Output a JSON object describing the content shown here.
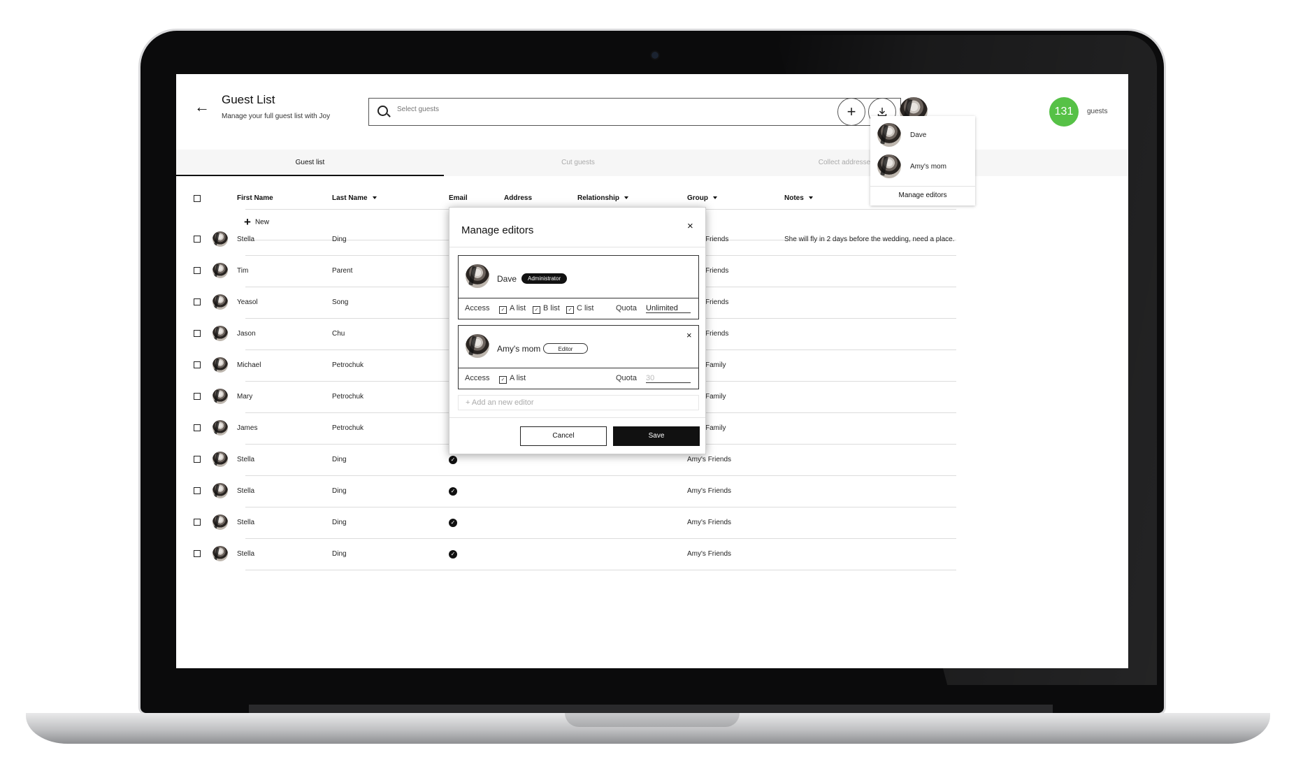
{
  "header": {
    "title": "Guest List",
    "subtitle": "Manage your full guest list with Joy",
    "search_placeholder": "Select guests",
    "guest_count": "131",
    "guest_count_label": "guests",
    "guest_count_color": "#56c146"
  },
  "icons": {
    "back": "arrow-left-icon",
    "search": "search-icon",
    "add": "plus-icon",
    "download": "download-icon"
  },
  "tabs": [
    {
      "label": "Guest list",
      "active": true
    },
    {
      "label": "Cut guests",
      "active": false
    },
    {
      "label": "Collect addresses",
      "active": false
    }
  ],
  "table": {
    "columns": {
      "first_name": "First Name",
      "last_name": "Last Name",
      "email": "Email",
      "address": "Address",
      "relationship": "Relationship",
      "group": "Group",
      "notes": "Notes"
    },
    "new_label": "New",
    "rows": [
      {
        "first": "Stella",
        "last": "Ding",
        "email": "",
        "group": "Friends",
        "notes": "She will fly in 2 days before the wedding, need a place."
      },
      {
        "first": "Tim",
        "last": "Parent",
        "email": "",
        "group": "Friends",
        "notes": ""
      },
      {
        "first": "Yeasol",
        "last": "Song",
        "email": "",
        "group": "Friends",
        "notes": ""
      },
      {
        "first": "Jason",
        "last": "Chu",
        "email": "",
        "group": "Friends",
        "notes": ""
      },
      {
        "first": "Michael",
        "last": "Petrochuk",
        "email": "",
        "group": "Family",
        "notes": ""
      },
      {
        "first": "Mary",
        "last": "Petrochuk",
        "email": "",
        "group": "Family",
        "notes": ""
      },
      {
        "first": "James",
        "last": "Petrochuk",
        "email": "",
        "group": "Family",
        "notes": ""
      },
      {
        "first": "Stella",
        "last": "Ding",
        "email": "✓",
        "group": "Amy's Friends",
        "notes": ""
      },
      {
        "first": "Stella",
        "last": "Ding",
        "email": "✓",
        "group": "Amy's Friends",
        "notes": ""
      },
      {
        "first": "Stella",
        "last": "Ding",
        "email": "✓",
        "group": "Amy's Friends",
        "notes": ""
      },
      {
        "first": "Stella",
        "last": "Ding",
        "email": "✓",
        "group": "Amy's Friends",
        "notes": ""
      }
    ]
  },
  "editors_dropdown": {
    "items": [
      {
        "name": "Dave"
      },
      {
        "name": "Amy's mom"
      }
    ],
    "manage_label": "Manage editors"
  },
  "modal": {
    "title": "Manage editors",
    "close": "×",
    "editors": [
      {
        "name": "Dave",
        "role": "Administrator",
        "access_label": "Access",
        "lists": [
          "A list",
          "B list",
          "C list"
        ],
        "quota_label": "Quota",
        "quota_value": "Unlimited"
      },
      {
        "name": "Amy's mom",
        "role": "Editor",
        "access_label": "Access",
        "lists": [
          "A list"
        ],
        "quota_label": "Quota",
        "quota_placeholder": "30"
      }
    ],
    "add_editor_placeholder": "+ Add an new editor",
    "cancel_label": "Cancel",
    "save_label": "Save"
  }
}
